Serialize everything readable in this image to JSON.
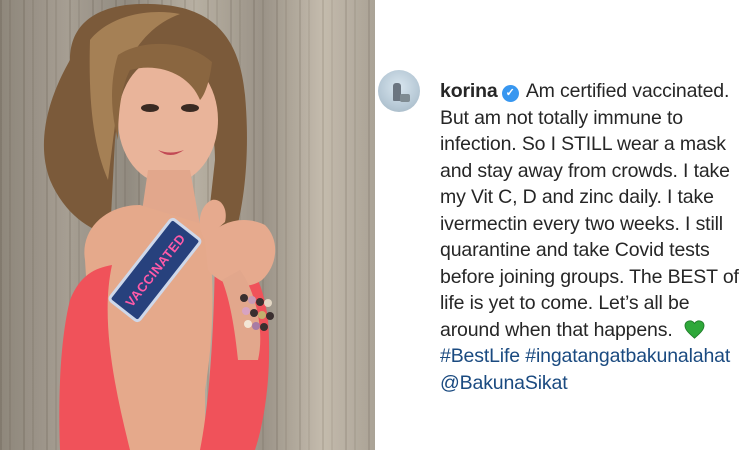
{
  "post": {
    "username": "korina",
    "verified_icon": "verified-badge-icon",
    "caption": "Am certified vaccinated. But am not totally immune to infection. So I STILL wear a mask and stay away from crowds. I take my Vit C, D and zinc daily. I take ivermectin every two weeks. I still quarantine and take Covid tests before joining groups. The BEST of life is yet to come. Let’s all be around when that happens.",
    "emoji": "green-heart-icon",
    "hashtags": [
      "#BestLife",
      "#ingatangatbakunalahat"
    ],
    "mention": "@BakunaSikat"
  },
  "photo": {
    "sticker_text": "VACCINATED"
  },
  "colors": {
    "verified_blue": "#3897f0",
    "link_blue": "#1a4a80",
    "heart_green": "#2fa83a",
    "dress_pink": "#f0525a"
  }
}
